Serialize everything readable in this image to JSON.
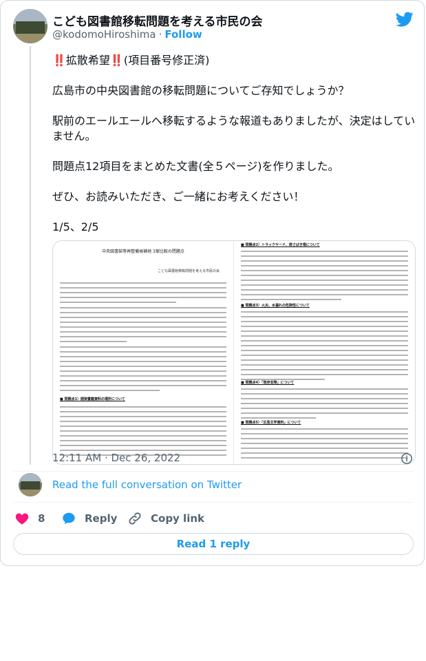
{
  "author": {
    "name": "こども図書館移転問題を考える市民の会",
    "handle": "@kodomoHiroshima",
    "separator": "·",
    "follow_label": "Follow"
  },
  "tweet": {
    "paragraphs": [
      "‼️拡散希望‼️(項目番号修正済)",
      "広島市の中央図書館の移転問題についてご存知でしょうか？",
      "駅前のエールエールへ移転するような報道もありましたが、決定はしていません。",
      "問題点12項目をまとめた文書(全５ページ)を作りました。",
      "ぜひ、お読みいただき、ご一緒にお考えください！",
      "1/5、2/5"
    ]
  },
  "media": {
    "left_page": {
      "title": "中央図書館等再整備候補地 3案比較の問題点",
      "subtitle": "こども図書館移転問題を考える市民の会",
      "heading": "■ 問題点1）開架書籍資料の場所について"
    },
    "right_page": {
      "heading1": "■ 問題点2）トラックヤード、荷さばき場について",
      "heading2": "■ 問題点3）火災、水漏れの危険性について",
      "heading3": "■ 問題点4）「既存支障」について",
      "heading4": "■ 問題点5）「広島文学資料」について"
    }
  },
  "meta": {
    "timestamp": "12:11 AM · Dec 26, 2022"
  },
  "conversation": {
    "read_full_label": "Read the full conversation on Twitter"
  },
  "actions": {
    "like_count": "8",
    "reply_label": "Reply",
    "copy_link_label": "Copy link"
  },
  "read_replies_label": "Read 1 reply",
  "colors": {
    "accent": "#1d9bf0",
    "like": "#f91880",
    "text": "#0f1419",
    "muted": "#536471",
    "border": "#cfd9de"
  },
  "icons": {
    "brand": "twitter-bird-icon",
    "info": "info-icon",
    "like": "heart-icon",
    "reply": "reply-bubble-icon",
    "copy": "link-icon"
  }
}
